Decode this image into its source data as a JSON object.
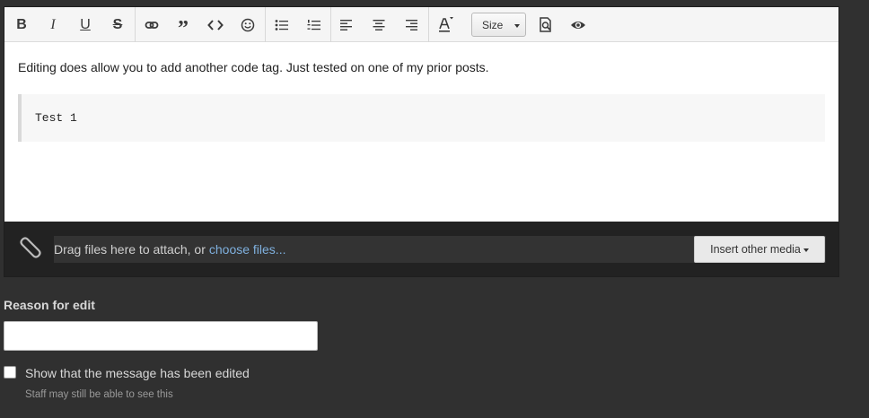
{
  "toolbar": {
    "buttons": [
      {
        "icon": "bold-icon",
        "glyph": "B"
      },
      {
        "icon": "italic-icon",
        "glyph": "I"
      },
      {
        "icon": "underline-icon",
        "glyph": "U"
      },
      {
        "icon": "strikethrough-icon",
        "glyph": "S"
      },
      {
        "icon": "link-icon"
      },
      {
        "icon": "quote-icon",
        "glyph": "”"
      },
      {
        "icon": "code-icon"
      },
      {
        "icon": "smilie-icon"
      },
      {
        "icon": "unordered-list-icon"
      },
      {
        "icon": "ordered-list-icon"
      },
      {
        "icon": "align-left-icon"
      },
      {
        "icon": "align-center-icon"
      },
      {
        "icon": "align-right-icon"
      },
      {
        "icon": "text-color-icon"
      },
      {
        "icon": "preview-icon"
      },
      {
        "icon": "view-source-icon"
      }
    ],
    "size_label": "Size"
  },
  "editor": {
    "text": "Editing does allow you to add another code tag. Just tested on one of my prior posts.",
    "code": "Test 1"
  },
  "attachments": {
    "drop_text": "Drag files here to attach, or",
    "choose_link": "choose files...",
    "insert_media_label": "Insert other media"
  },
  "reason": {
    "label": "Reason for edit",
    "value": "",
    "placeholder": ""
  },
  "show_edited": {
    "label": "Show that the message has been edited",
    "hint": "Staff may still be able to see this",
    "checked": false
  },
  "colors": {
    "page_bg": "#303030",
    "toolbar_bg": "#f5f5f5",
    "attach_bar_bg": "#222222",
    "link": "#7fb0de"
  }
}
